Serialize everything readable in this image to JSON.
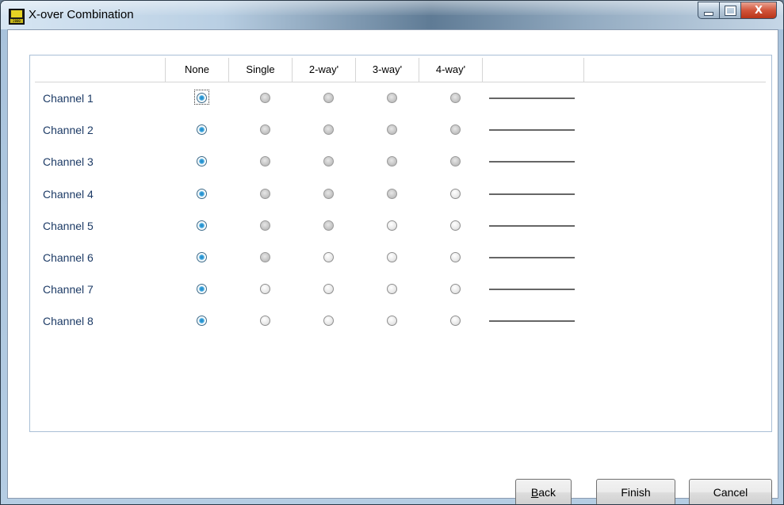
{
  "window": {
    "title": "X-over Combination",
    "controls": {
      "minimize": "minimize",
      "maximize": "maximize",
      "close": "X"
    }
  },
  "app_icon": {
    "text": "2000"
  },
  "table": {
    "columns": [
      "None",
      "Single",
      "2-way'",
      "3-way'",
      "4-way'",
      ""
    ],
    "rows": [
      {
        "label": "Channel 1",
        "selected": "None",
        "enabled": [
          "None",
          "Single",
          "2-way'",
          "3-way'",
          "4-way'"
        ]
      },
      {
        "label": "Channel 2",
        "selected": "None",
        "enabled": [
          "None",
          "Single",
          "2-way'",
          "3-way'",
          "4-way'"
        ]
      },
      {
        "label": "Channel 3",
        "selected": "None",
        "enabled": [
          "None",
          "Single",
          "2-way'",
          "3-way'",
          "4-way'"
        ]
      },
      {
        "label": "Channel 4",
        "selected": "None",
        "enabled": [
          "None",
          "Single",
          "2-way'",
          "3-way'",
          "4-way'"
        ]
      },
      {
        "label": "Channel 5",
        "selected": "None",
        "enabled": [
          "None",
          "Single",
          "2-way'",
          "3-way'",
          "4-way'"
        ]
      },
      {
        "label": "Channel 6",
        "selected": "None",
        "enabled": [
          "None",
          "Single",
          "2-way'",
          "3-way'",
          "4-way'"
        ]
      },
      {
        "label": "Channel 7",
        "selected": "None",
        "enabled": [
          "None",
          "Single",
          "2-way'",
          "3-way'",
          "4-way'"
        ]
      },
      {
        "label": "Channel 8",
        "selected": "None",
        "enabled": [
          "None",
          "Single",
          "2-way'",
          "3-way'",
          "4-way'"
        ]
      }
    ]
  },
  "buttons": {
    "back_prefix": "B",
    "back_rest": "ack",
    "finish": "Finish",
    "cancel": "Cancel"
  }
}
